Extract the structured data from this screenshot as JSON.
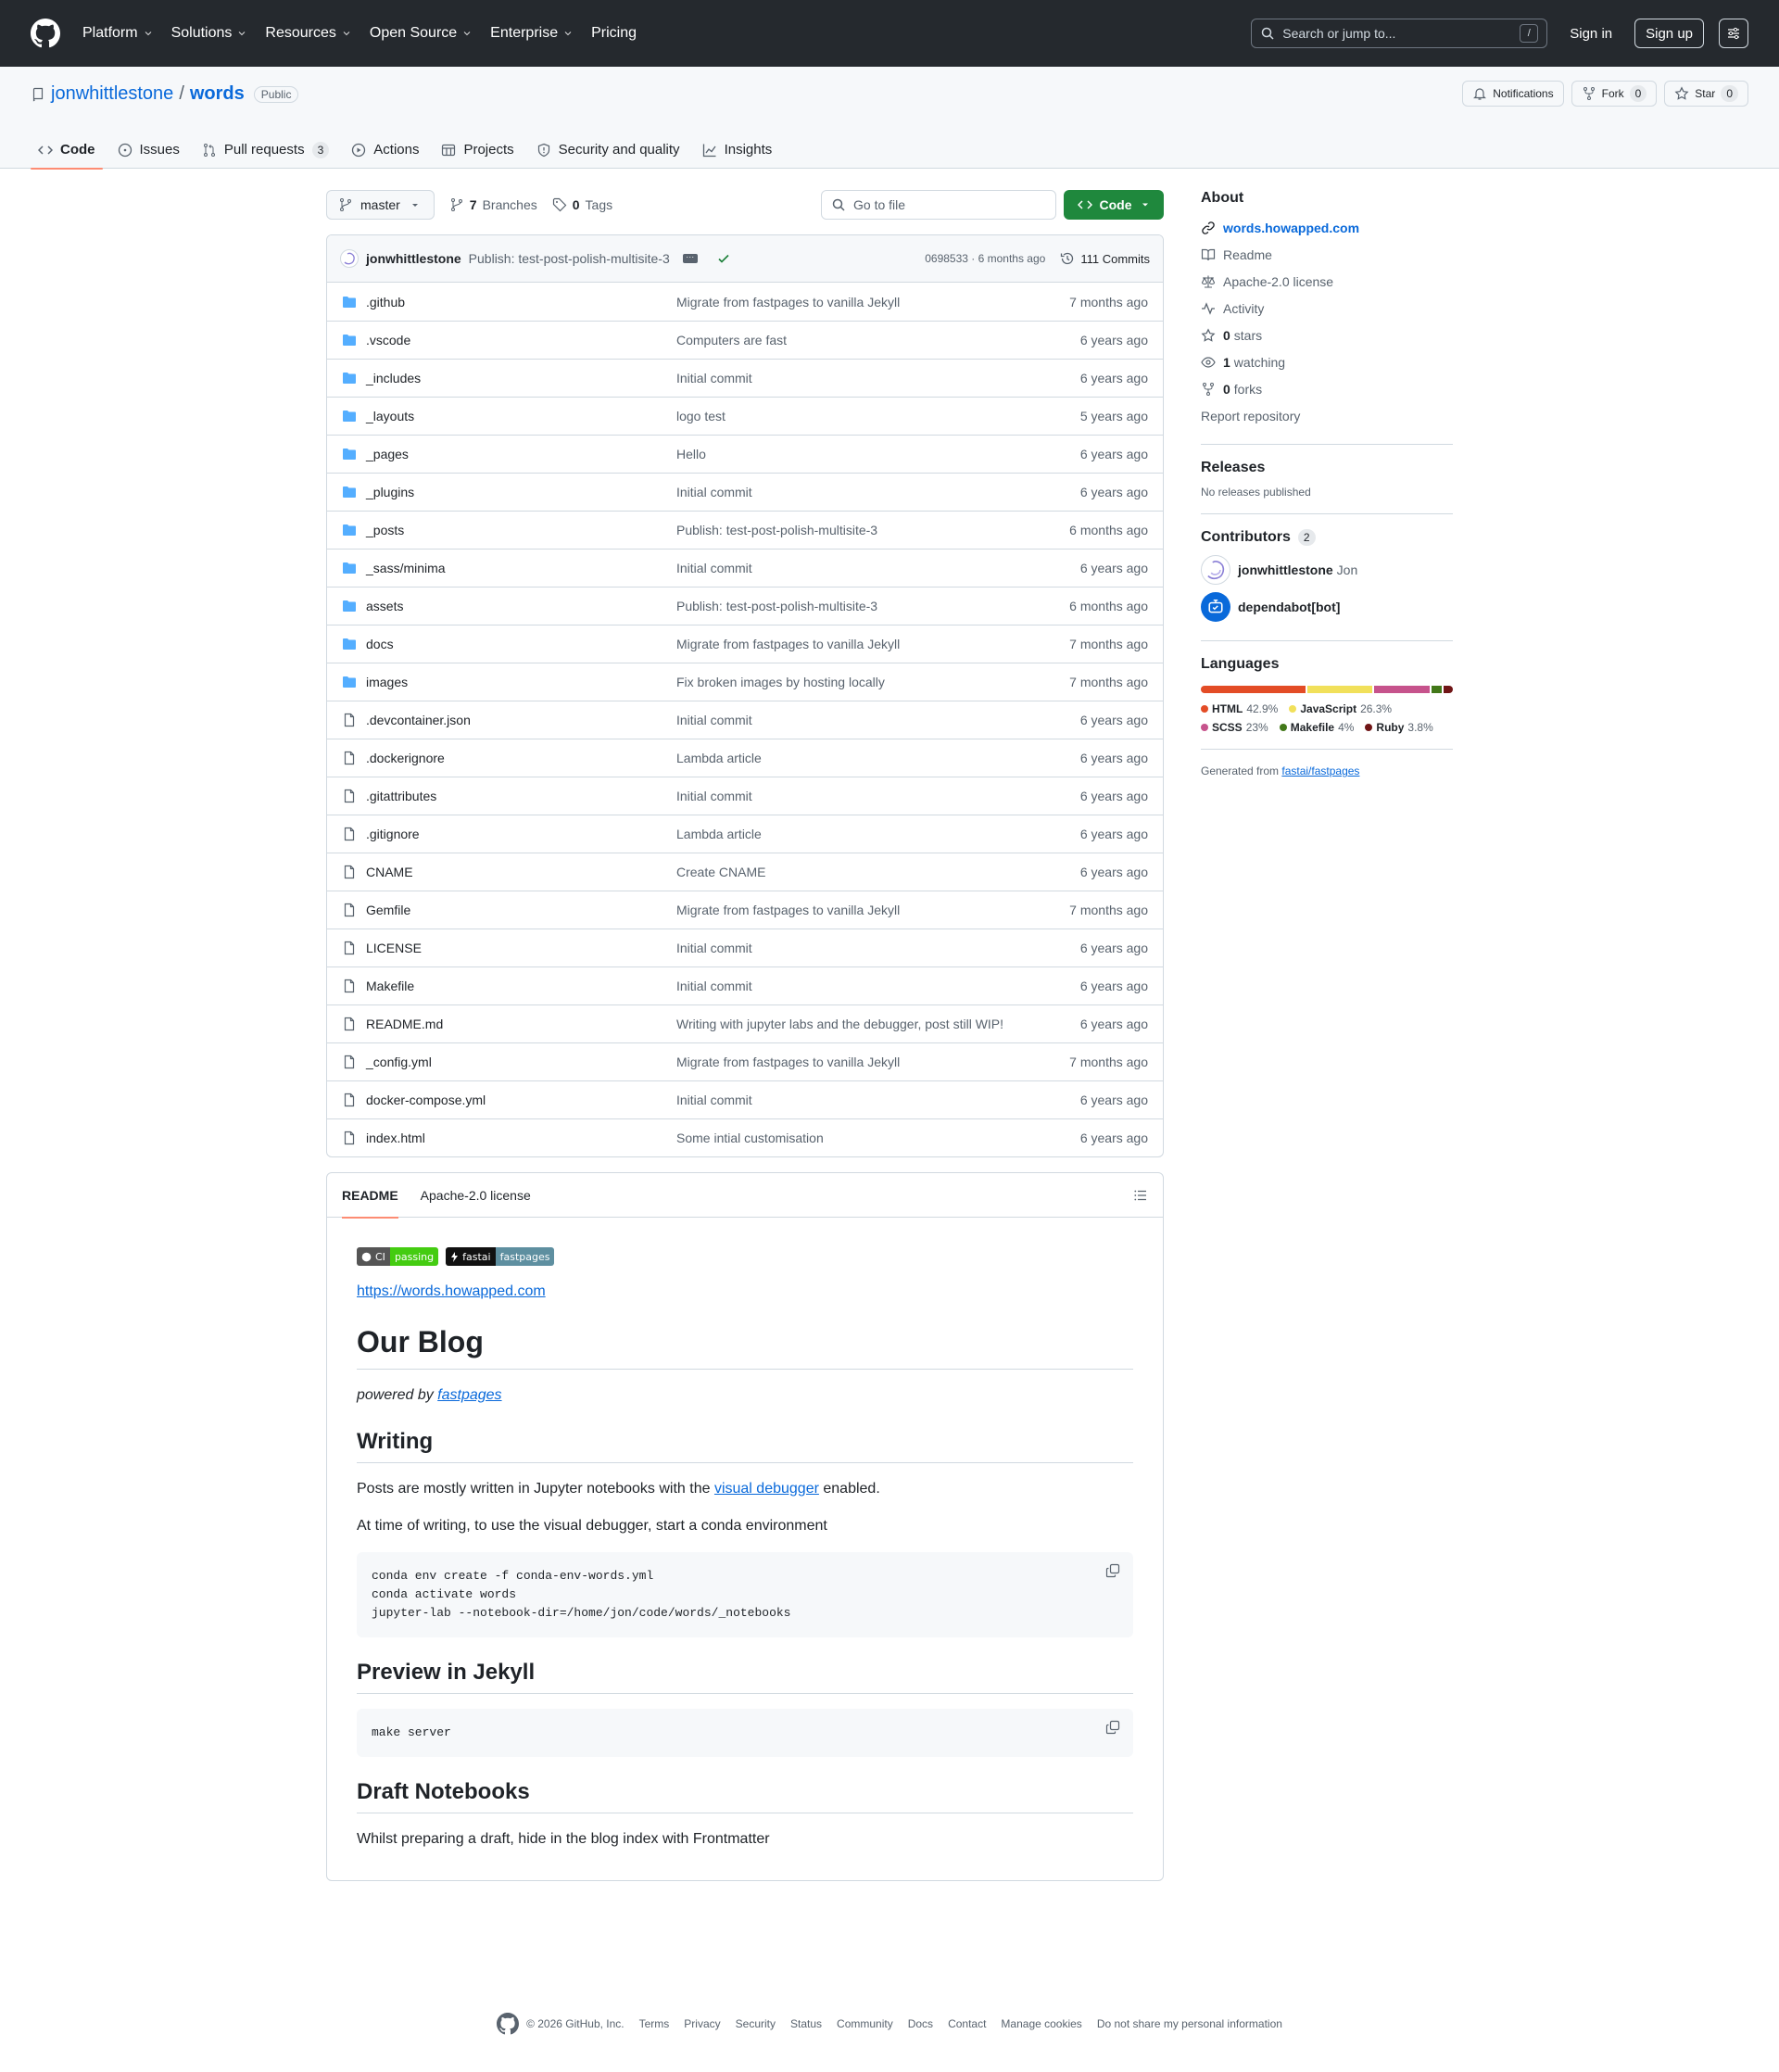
{
  "nav": {
    "items": [
      "Platform",
      "Solutions",
      "Resources",
      "Open Source",
      "Enterprise",
      "Pricing"
    ],
    "search_placeholder": "Search or jump to...",
    "search_key": "/",
    "sign_in": "Sign in",
    "sign_up": "Sign up"
  },
  "repo": {
    "owner": "jonwhittlestone",
    "sep": "/",
    "name": "words",
    "visibility": "Public",
    "notifications": "Notifications",
    "fork": "Fork",
    "fork_count": "0",
    "star": "Star",
    "star_count": "0"
  },
  "tabs": [
    {
      "label": "Code",
      "icon": "code-icon"
    },
    {
      "label": "Issues",
      "icon": "issue-icon"
    },
    {
      "label": "Pull requests",
      "icon": "pull-request-icon",
      "count": "3"
    },
    {
      "label": "Actions",
      "icon": "play-icon"
    },
    {
      "label": "Projects",
      "icon": "table-icon"
    },
    {
      "label": "Security and quality",
      "icon": "shield-icon"
    },
    {
      "label": "Insights",
      "icon": "graph-icon"
    }
  ],
  "toolbar": {
    "branch": "master",
    "branches_count": "7",
    "branches_label": "Branches",
    "tags_count": "0",
    "tags_label": "Tags",
    "goto_placeholder": "Go to file",
    "code_button": "Code"
  },
  "commit": {
    "author": "jonwhittlestone",
    "message": "Publish: test-post-polish-multisite-3",
    "hash_time": "0698533 · 6 months ago",
    "commits_label": "111 Commits"
  },
  "files": [
    {
      "name": ".github",
      "type": "dir",
      "msg": "Migrate from fastpages to vanilla Jekyll",
      "age": "7 months ago"
    },
    {
      "name": ".vscode",
      "type": "dir",
      "msg": "Computers are fast",
      "age": "6 years ago"
    },
    {
      "name": "_includes",
      "type": "dir",
      "msg": "Initial commit",
      "age": "6 years ago"
    },
    {
      "name": "_layouts",
      "type": "dir",
      "msg": "logo test",
      "age": "5 years ago"
    },
    {
      "name": "_pages",
      "type": "dir",
      "msg": "Hello",
      "age": "6 years ago"
    },
    {
      "name": "_plugins",
      "type": "dir",
      "msg": "Initial commit",
      "age": "6 years ago"
    },
    {
      "name": "_posts",
      "type": "dir",
      "msg": "Publish: test-post-polish-multisite-3",
      "age": "6 months ago"
    },
    {
      "name": "_sass/minima",
      "type": "dir",
      "msg": "Initial commit",
      "age": "6 years ago"
    },
    {
      "name": "assets",
      "type": "dir",
      "msg": "Publish: test-post-polish-multisite-3",
      "age": "6 months ago"
    },
    {
      "name": "docs",
      "type": "dir",
      "msg": "Migrate from fastpages to vanilla Jekyll",
      "age": "7 months ago"
    },
    {
      "name": "images",
      "type": "dir",
      "msg": "Fix broken images by hosting locally",
      "age": "7 months ago"
    },
    {
      "name": ".devcontainer.json",
      "type": "file",
      "msg": "Initial commit",
      "age": "6 years ago"
    },
    {
      "name": ".dockerignore",
      "type": "file",
      "msg": "Lambda article",
      "age": "6 years ago"
    },
    {
      "name": ".gitattributes",
      "type": "file",
      "msg": "Initial commit",
      "age": "6 years ago"
    },
    {
      "name": ".gitignore",
      "type": "file",
      "msg": "Lambda article",
      "age": "6 years ago"
    },
    {
      "name": "CNAME",
      "type": "file",
      "msg": "Create CNAME",
      "age": "6 years ago"
    },
    {
      "name": "Gemfile",
      "type": "file",
      "msg": "Migrate from fastpages to vanilla Jekyll",
      "age": "7 months ago"
    },
    {
      "name": "LICENSE",
      "type": "file",
      "msg": "Initial commit",
      "age": "6 years ago"
    },
    {
      "name": "Makefile",
      "type": "file",
      "msg": "Initial commit",
      "age": "6 years ago"
    },
    {
      "name": "README.md",
      "type": "file",
      "msg": "Writing with jupyter labs and the debugger, post still WIP!",
      "age": "6 years ago"
    },
    {
      "name": "_config.yml",
      "type": "file",
      "msg": "Migrate from fastpages to vanilla Jekyll",
      "age": "7 months ago"
    },
    {
      "name": "docker-compose.yml",
      "type": "file",
      "msg": "Initial commit",
      "age": "6 years ago"
    },
    {
      "name": "index.html",
      "type": "file",
      "msg": "Some intial customisation",
      "age": "6 years ago"
    }
  ],
  "readme": {
    "tab_readme": "README",
    "tab_license": "Apache-2.0 license",
    "badge1_left": "CI",
    "badge1_right": "passing",
    "badge2_left": "fastai",
    "badge2_right": "fastpages",
    "site_link": "https://words.howapped.com",
    "h1": "Our Blog",
    "powered_prefix": "powered by ",
    "powered_link": "fastpages",
    "h2_writing": "Writing",
    "p1_before": "Posts are mostly written in Jupyter notebooks with the ",
    "p1_link": "visual debugger",
    "p1_after": " enabled.",
    "p2": "At time of writing, to use the visual debugger, start a conda environment",
    "code1": "conda env create -f conda-env-words.yml\nconda activate words\njupyter-lab --notebook-dir=/home/jon/code/words/_notebooks",
    "h2_preview": "Preview in Jekyll",
    "code2": "make server",
    "h2_draft": "Draft Notebooks",
    "p3": "Whilst preparing a draft, hide in the blog index with Frontmatter"
  },
  "about": {
    "title": "About",
    "website": "words.howapped.com",
    "readme": "Readme",
    "license": "Apache-2.0 license",
    "activity": "Activity",
    "stars_n": "0",
    "stars": "stars",
    "watching_n": "1",
    "watching": "watching",
    "forks_n": "0",
    "forks": "forks",
    "report": "Report repository"
  },
  "releases": {
    "title": "Releases",
    "none": "No releases published"
  },
  "contributors": {
    "title": "Contributors",
    "count": "2",
    "list": [
      {
        "login": "jonwhittlestone",
        "name": "Jon"
      },
      {
        "login": "dependabot[bot]",
        "name": ""
      }
    ]
  },
  "languages": {
    "title": "Languages",
    "items": [
      {
        "name": "HTML",
        "pct": "42.9%",
        "value": 42.9,
        "color": "#e34c26"
      },
      {
        "name": "JavaScript",
        "pct": "26.3%",
        "value": 26.3,
        "color": "#f1e05a"
      },
      {
        "name": "SCSS",
        "pct": "23%",
        "value": 23,
        "color": "#c6538c"
      },
      {
        "name": "Makefile",
        "pct": "4%",
        "value": 4,
        "color": "#427819"
      },
      {
        "name": "Ruby",
        "pct": "3.8%",
        "value": 3.8,
        "color": "#701516"
      }
    ]
  },
  "generated": {
    "prefix": "Generated from ",
    "link": "fastai/fastpages"
  },
  "footer": {
    "copyright": "© 2026 GitHub, Inc.",
    "links": [
      "Terms",
      "Privacy",
      "Security",
      "Status",
      "Community",
      "Docs",
      "Contact",
      "Manage cookies",
      "Do not share my personal information"
    ]
  }
}
